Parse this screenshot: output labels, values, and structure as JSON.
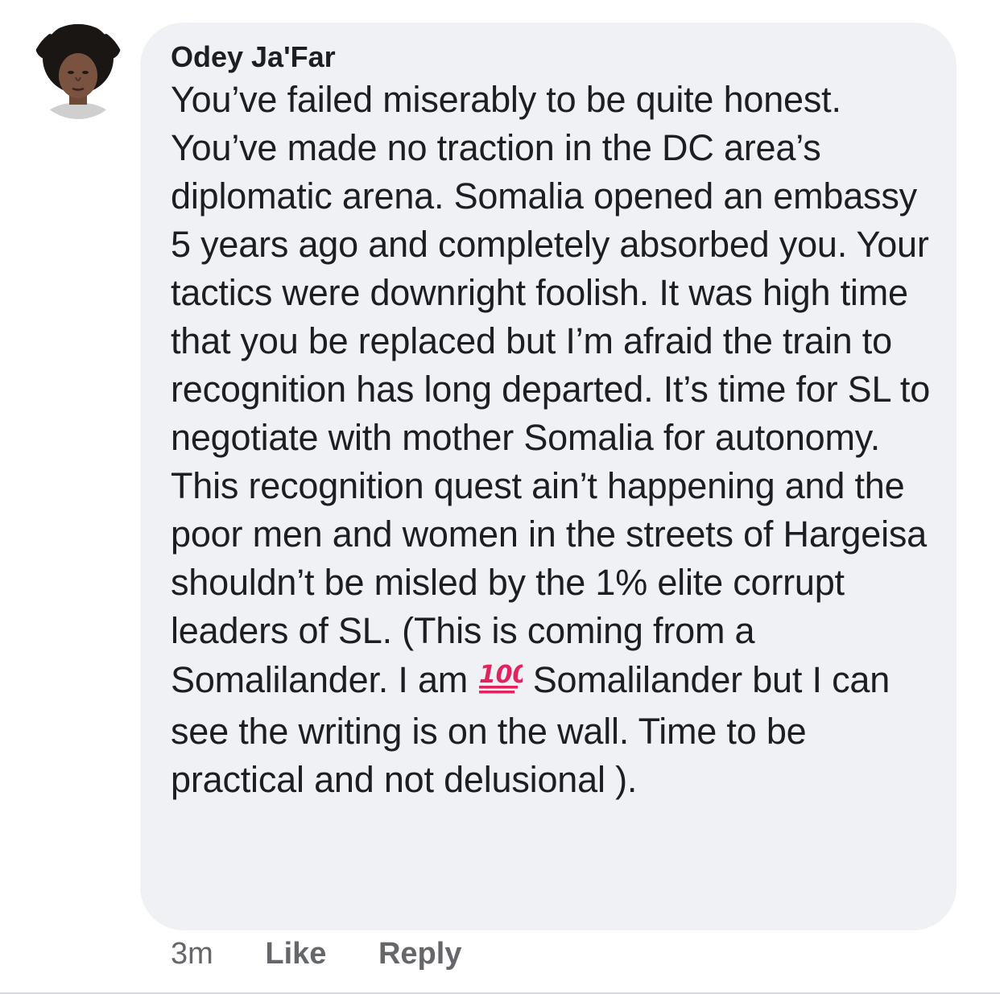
{
  "comment": {
    "author": "Odey Ja'Far",
    "avatar_icon": "profile-photo",
    "text_part1": "You’ve failed miserably to be quite honest. You’ve made no traction in the DC area’s diplomatic arena. Somalia opened an embassy 5 years ago and completely absorbed you. Your tactics were downright foolish. It was high time that you be replaced but I’m afraid the train to recognition has long departed. It’s time for SL to negotiate with mother Somalia for autonomy. This recognition quest ain’t happening and the poor men and women in the streets of Hargeisa shouldn’t be misled by the 1% elite corrupt leaders of SL. (This is coming from a Somalilander.  I am ",
    "emoji": "💯",
    "emoji_icon": "hundred-points-icon",
    "text_part2": " Somalilander but I can see the writing is on the wall. Time to be practical and not delusional ).",
    "time": "3m",
    "like_label": "Like",
    "reply_label": "Reply"
  },
  "colors": {
    "bubble_bg": "#f0f1f4",
    "text": "#1c1e21",
    "meta": "#65676b",
    "emoji_red": "#e0245e"
  }
}
